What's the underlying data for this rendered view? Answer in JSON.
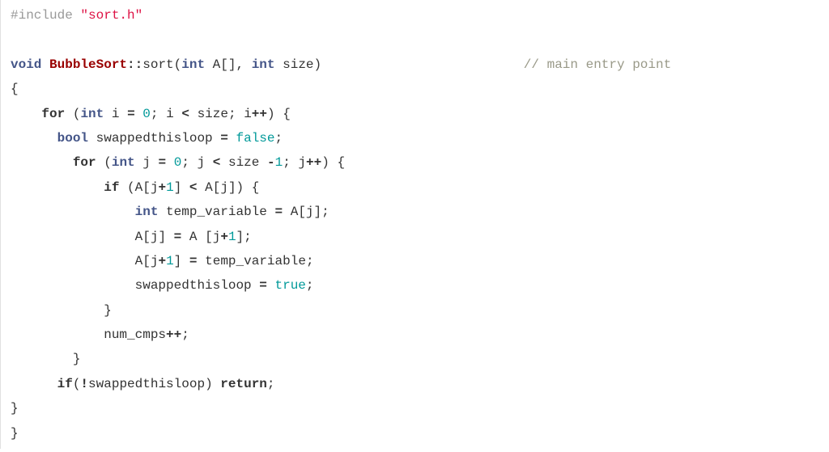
{
  "code": {
    "lines": [
      {
        "indent": 0,
        "tokens": [
          {
            "t": "pp",
            "v": "#include "
          },
          {
            "t": "str",
            "v": "\"sort.h\""
          }
        ]
      },
      {
        "indent": 0,
        "tokens": []
      },
      {
        "indent": 0,
        "tokens": [
          {
            "t": "type",
            "v": "void"
          },
          {
            "t": "sp",
            "v": " "
          },
          {
            "t": "fn",
            "v": "BubbleSort"
          },
          {
            "t": "op",
            "v": "::"
          },
          {
            "t": "id",
            "v": "sort"
          },
          {
            "t": "pun",
            "v": "("
          },
          {
            "t": "type",
            "v": "int"
          },
          {
            "t": "sp",
            "v": " "
          },
          {
            "t": "id",
            "v": "A"
          },
          {
            "t": "pun",
            "v": "[],"
          },
          {
            "t": "sp",
            "v": " "
          },
          {
            "t": "type",
            "v": "int"
          },
          {
            "t": "sp",
            "v": " "
          },
          {
            "t": "id",
            "v": "size"
          },
          {
            "t": "pun",
            "v": ")"
          },
          {
            "t": "sp",
            "v": "                          "
          },
          {
            "t": "com",
            "v": "// main entry point"
          }
        ]
      },
      {
        "indent": 0,
        "tokens": [
          {
            "t": "pun",
            "v": "{"
          }
        ]
      },
      {
        "indent": 4,
        "tokens": [
          {
            "t": "kw",
            "v": "for"
          },
          {
            "t": "sp",
            "v": " "
          },
          {
            "t": "pun",
            "v": "("
          },
          {
            "t": "type",
            "v": "int"
          },
          {
            "t": "sp",
            "v": " "
          },
          {
            "t": "id",
            "v": "i"
          },
          {
            "t": "sp",
            "v": " "
          },
          {
            "t": "op",
            "v": "="
          },
          {
            "t": "sp",
            "v": " "
          },
          {
            "t": "num",
            "v": "0"
          },
          {
            "t": "pun",
            "v": ";"
          },
          {
            "t": "sp",
            "v": " "
          },
          {
            "t": "id",
            "v": "i"
          },
          {
            "t": "sp",
            "v": " "
          },
          {
            "t": "op",
            "v": "<"
          },
          {
            "t": "sp",
            "v": " "
          },
          {
            "t": "id",
            "v": "size"
          },
          {
            "t": "pun",
            "v": ";"
          },
          {
            "t": "sp",
            "v": " "
          },
          {
            "t": "id",
            "v": "i"
          },
          {
            "t": "op",
            "v": "++"
          },
          {
            "t": "pun",
            "v": ")"
          },
          {
            "t": "sp",
            "v": " "
          },
          {
            "t": "pun",
            "v": "{"
          }
        ]
      },
      {
        "indent": 6,
        "tokens": [
          {
            "t": "type",
            "v": "bool"
          },
          {
            "t": "sp",
            "v": " "
          },
          {
            "t": "id",
            "v": "swappedthisloop"
          },
          {
            "t": "sp",
            "v": " "
          },
          {
            "t": "op",
            "v": "="
          },
          {
            "t": "sp",
            "v": " "
          },
          {
            "t": "bool",
            "v": "false"
          },
          {
            "t": "pun",
            "v": ";"
          }
        ]
      },
      {
        "indent": 8,
        "tokens": [
          {
            "t": "kw",
            "v": "for"
          },
          {
            "t": "sp",
            "v": " "
          },
          {
            "t": "pun",
            "v": "("
          },
          {
            "t": "type",
            "v": "int"
          },
          {
            "t": "sp",
            "v": " "
          },
          {
            "t": "id",
            "v": "j"
          },
          {
            "t": "sp",
            "v": " "
          },
          {
            "t": "op",
            "v": "="
          },
          {
            "t": "sp",
            "v": " "
          },
          {
            "t": "num",
            "v": "0"
          },
          {
            "t": "pun",
            "v": ";"
          },
          {
            "t": "sp",
            "v": " "
          },
          {
            "t": "id",
            "v": "j"
          },
          {
            "t": "sp",
            "v": " "
          },
          {
            "t": "op",
            "v": "<"
          },
          {
            "t": "sp",
            "v": " "
          },
          {
            "t": "id",
            "v": "size"
          },
          {
            "t": "sp",
            "v": " "
          },
          {
            "t": "op",
            "v": "-"
          },
          {
            "t": "num",
            "v": "1"
          },
          {
            "t": "pun",
            "v": ";"
          },
          {
            "t": "sp",
            "v": " "
          },
          {
            "t": "id",
            "v": "j"
          },
          {
            "t": "op",
            "v": "++"
          },
          {
            "t": "pun",
            "v": ")"
          },
          {
            "t": "sp",
            "v": " "
          },
          {
            "t": "pun",
            "v": "{"
          }
        ]
      },
      {
        "indent": 12,
        "tokens": [
          {
            "t": "kw",
            "v": "if"
          },
          {
            "t": "sp",
            "v": " "
          },
          {
            "t": "pun",
            "v": "("
          },
          {
            "t": "id",
            "v": "A"
          },
          {
            "t": "pun",
            "v": "["
          },
          {
            "t": "id",
            "v": "j"
          },
          {
            "t": "op",
            "v": "+"
          },
          {
            "t": "num",
            "v": "1"
          },
          {
            "t": "pun",
            "v": "]"
          },
          {
            "t": "sp",
            "v": " "
          },
          {
            "t": "op",
            "v": "<"
          },
          {
            "t": "sp",
            "v": " "
          },
          {
            "t": "id",
            "v": "A"
          },
          {
            "t": "pun",
            "v": "["
          },
          {
            "t": "id",
            "v": "j"
          },
          {
            "t": "pun",
            "v": "])"
          },
          {
            "t": "sp",
            "v": " "
          },
          {
            "t": "pun",
            "v": "{"
          }
        ]
      },
      {
        "indent": 16,
        "tokens": [
          {
            "t": "type",
            "v": "int"
          },
          {
            "t": "sp",
            "v": " "
          },
          {
            "t": "id",
            "v": "temp_variable"
          },
          {
            "t": "sp",
            "v": " "
          },
          {
            "t": "op",
            "v": "="
          },
          {
            "t": "sp",
            "v": " "
          },
          {
            "t": "id",
            "v": "A"
          },
          {
            "t": "pun",
            "v": "["
          },
          {
            "t": "id",
            "v": "j"
          },
          {
            "t": "pun",
            "v": "];"
          }
        ]
      },
      {
        "indent": 16,
        "tokens": [
          {
            "t": "id",
            "v": "A"
          },
          {
            "t": "pun",
            "v": "["
          },
          {
            "t": "id",
            "v": "j"
          },
          {
            "t": "pun",
            "v": "]"
          },
          {
            "t": "sp",
            "v": " "
          },
          {
            "t": "op",
            "v": "="
          },
          {
            "t": "sp",
            "v": " "
          },
          {
            "t": "id",
            "v": "A"
          },
          {
            "t": "sp",
            "v": " "
          },
          {
            "t": "pun",
            "v": "["
          },
          {
            "t": "id",
            "v": "j"
          },
          {
            "t": "op",
            "v": "+"
          },
          {
            "t": "num",
            "v": "1"
          },
          {
            "t": "pun",
            "v": "];"
          }
        ]
      },
      {
        "indent": 16,
        "tokens": [
          {
            "t": "id",
            "v": "A"
          },
          {
            "t": "pun",
            "v": "["
          },
          {
            "t": "id",
            "v": "j"
          },
          {
            "t": "op",
            "v": "+"
          },
          {
            "t": "num",
            "v": "1"
          },
          {
            "t": "pun",
            "v": "]"
          },
          {
            "t": "sp",
            "v": " "
          },
          {
            "t": "op",
            "v": "="
          },
          {
            "t": "sp",
            "v": " "
          },
          {
            "t": "id",
            "v": "temp_variable"
          },
          {
            "t": "pun",
            "v": ";"
          }
        ]
      },
      {
        "indent": 16,
        "tokens": [
          {
            "t": "id",
            "v": "swappedthisloop"
          },
          {
            "t": "sp",
            "v": " "
          },
          {
            "t": "op",
            "v": "="
          },
          {
            "t": "sp",
            "v": " "
          },
          {
            "t": "bool",
            "v": "true"
          },
          {
            "t": "pun",
            "v": ";"
          }
        ]
      },
      {
        "indent": 12,
        "tokens": [
          {
            "t": "pun",
            "v": "}"
          }
        ]
      },
      {
        "indent": 12,
        "tokens": [
          {
            "t": "id",
            "v": "num_cmps"
          },
          {
            "t": "op",
            "v": "++"
          },
          {
            "t": "pun",
            "v": ";"
          }
        ]
      },
      {
        "indent": 8,
        "tokens": [
          {
            "t": "pun",
            "v": "}"
          }
        ]
      },
      {
        "indent": 6,
        "tokens": [
          {
            "t": "kw",
            "v": "if"
          },
          {
            "t": "pun",
            "v": "("
          },
          {
            "t": "op",
            "v": "!"
          },
          {
            "t": "id",
            "v": "swappedthisloop"
          },
          {
            "t": "pun",
            "v": ")"
          },
          {
            "t": "sp",
            "v": " "
          },
          {
            "t": "kw",
            "v": "return"
          },
          {
            "t": "pun",
            "v": ";"
          }
        ]
      },
      {
        "indent": 0,
        "tokens": [
          {
            "t": "pun",
            "v": "}"
          }
        ]
      },
      {
        "indent": 0,
        "tokens": [
          {
            "t": "pun",
            "v": "}"
          }
        ]
      }
    ]
  }
}
